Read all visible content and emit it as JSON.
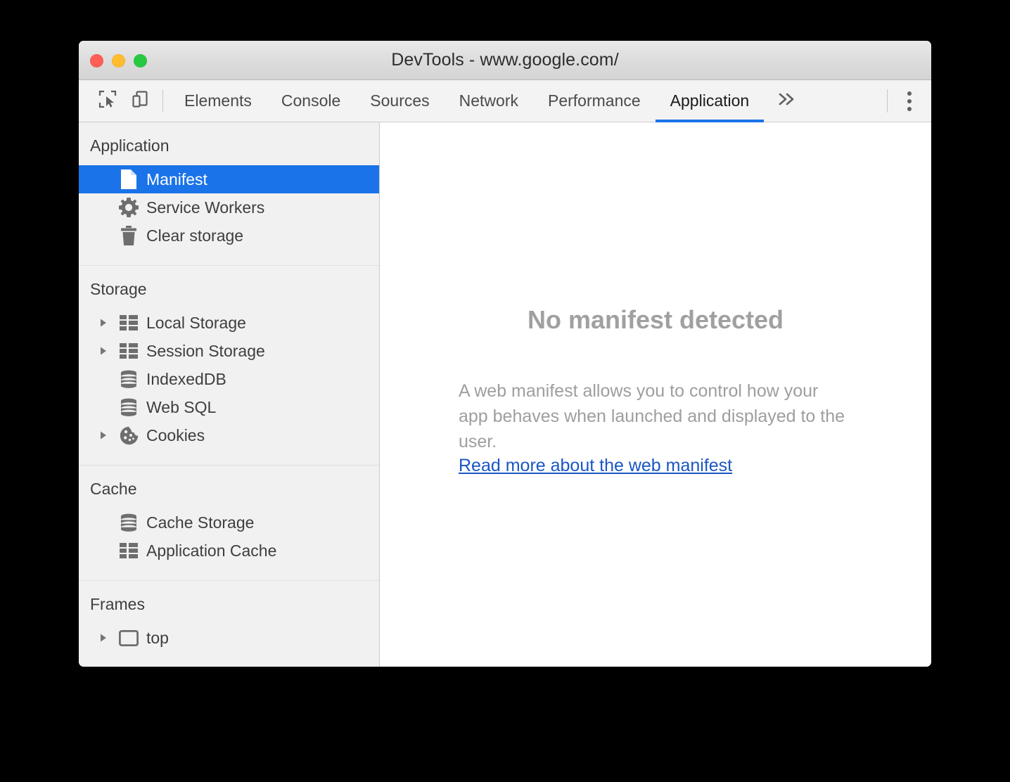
{
  "window": {
    "title": "DevTools - www.google.com/",
    "traffic_lights": [
      {
        "name": "close",
        "color": "#FF5F57"
      },
      {
        "name": "minimize",
        "color": "#FEBC2E"
      },
      {
        "name": "zoom",
        "color": "#28C840"
      }
    ]
  },
  "toolbar": {
    "inspect_icon": "inspect-element-icon",
    "device_toggle_icon": "device-toolbar-icon",
    "more_tabs_label": "»",
    "more_options_icon": "kebab-menu-icon"
  },
  "tabs": [
    {
      "label": "Elements",
      "selected": false
    },
    {
      "label": "Console",
      "selected": false
    },
    {
      "label": "Sources",
      "selected": false
    },
    {
      "label": "Network",
      "selected": false
    },
    {
      "label": "Performance",
      "selected": false
    },
    {
      "label": "Application",
      "selected": true
    }
  ],
  "sidebar": {
    "sections": [
      {
        "title": "Application",
        "items": [
          {
            "label": "Manifest",
            "icon": "page-file-icon",
            "selected": true,
            "twisty": false
          },
          {
            "label": "Service Workers",
            "icon": "gear-icon",
            "selected": false,
            "twisty": false
          },
          {
            "label": "Clear storage",
            "icon": "trash-icon",
            "selected": false,
            "twisty": false
          }
        ]
      },
      {
        "title": "Storage",
        "items": [
          {
            "label": "Local Storage",
            "icon": "table-grid-icon",
            "selected": false,
            "twisty": true
          },
          {
            "label": "Session Storage",
            "icon": "table-grid-icon",
            "selected": false,
            "twisty": true
          },
          {
            "label": "IndexedDB",
            "icon": "database-icon",
            "selected": false,
            "twisty": false
          },
          {
            "label": "Web SQL",
            "icon": "database-icon",
            "selected": false,
            "twisty": false
          },
          {
            "label": "Cookies",
            "icon": "cookie-icon",
            "selected": false,
            "twisty": true
          }
        ]
      },
      {
        "title": "Cache",
        "items": [
          {
            "label": "Cache Storage",
            "icon": "database-icon",
            "selected": false,
            "twisty": false
          },
          {
            "label": "Application Cache",
            "icon": "table-grid-icon",
            "selected": false,
            "twisty": false
          }
        ]
      },
      {
        "title": "Frames",
        "items": [
          {
            "label": "top",
            "icon": "frame-icon",
            "selected": false,
            "twisty": true
          }
        ]
      }
    ]
  },
  "main": {
    "empty_title": "No manifest detected",
    "empty_description": "A web manifest allows you to control how your app behaves when launched and displayed to the user.",
    "link_label": "Read more about the web manifest"
  },
  "colors": {
    "selection_blue": "#1A73E8",
    "link_blue": "#1A56C4",
    "sidebar_bg": "#F1F1F1",
    "tabbar_bg": "#F3F3F3",
    "icon_gray": "#6E6E6E",
    "muted_text": "#9E9E9E"
  }
}
